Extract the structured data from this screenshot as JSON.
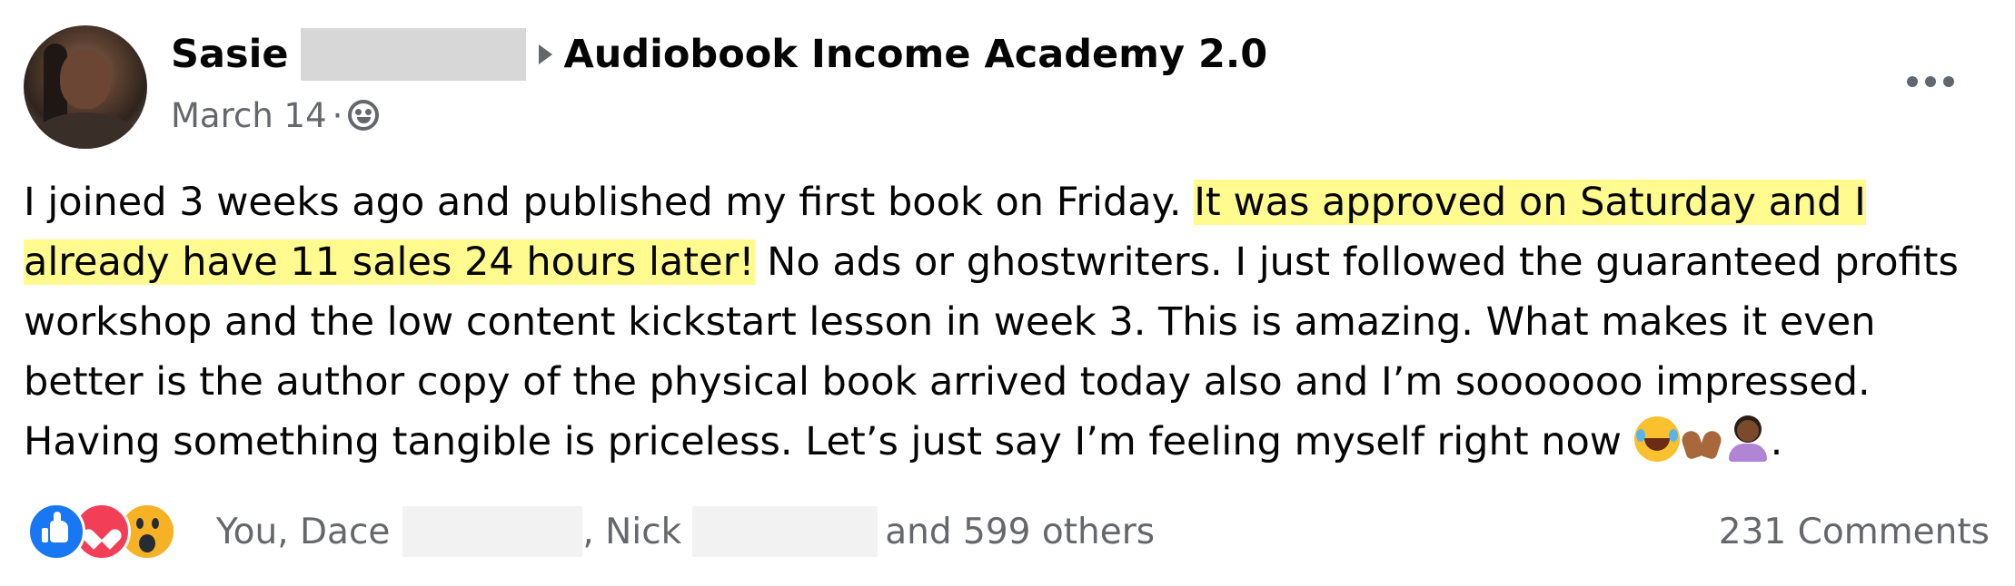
{
  "post": {
    "author": "Sasie",
    "group": "Audiobook Income Academy 2.0",
    "date": "March 14",
    "meta_separator": "·",
    "audience_icon": "group-members-icon",
    "more_icon": "more-options-icon",
    "text": {
      "part1": "I joined 3 weeks ago and published my first book on Friday. ",
      "highlight": "It was approved on Saturday and I already have 11 sales 24 hours later!",
      "part2": " No ads or ghostwriters. I just followed the guaranteed profits workshop and the low content kickstart lesson in week 3. This is amazing. What makes it even better is the author copy of the physical book arrived today also and I’m sooooooo impressed. Having something tangible is priceless. Let’s just say I’m feeling myself right now ",
      "emojis": [
        "tears-of-joy-emoji",
        "raising-hands-emoji",
        "person-tipping-hand-emoji"
      ],
      "ending": "."
    },
    "highlight_color": "#fffb8f"
  },
  "footer": {
    "reaction_icons": [
      "like-icon",
      "love-icon",
      "wow-icon"
    ],
    "reaction_prefix": "You, Dace",
    "reaction_mid": ", Nick",
    "reaction_suffix": "and 599 others",
    "comments": "231 Comments"
  },
  "colors": {
    "text": "#050505",
    "secondary": "#65676b",
    "like": "#1877f2",
    "love": "#f33e58",
    "wow": "#f7b125"
  }
}
